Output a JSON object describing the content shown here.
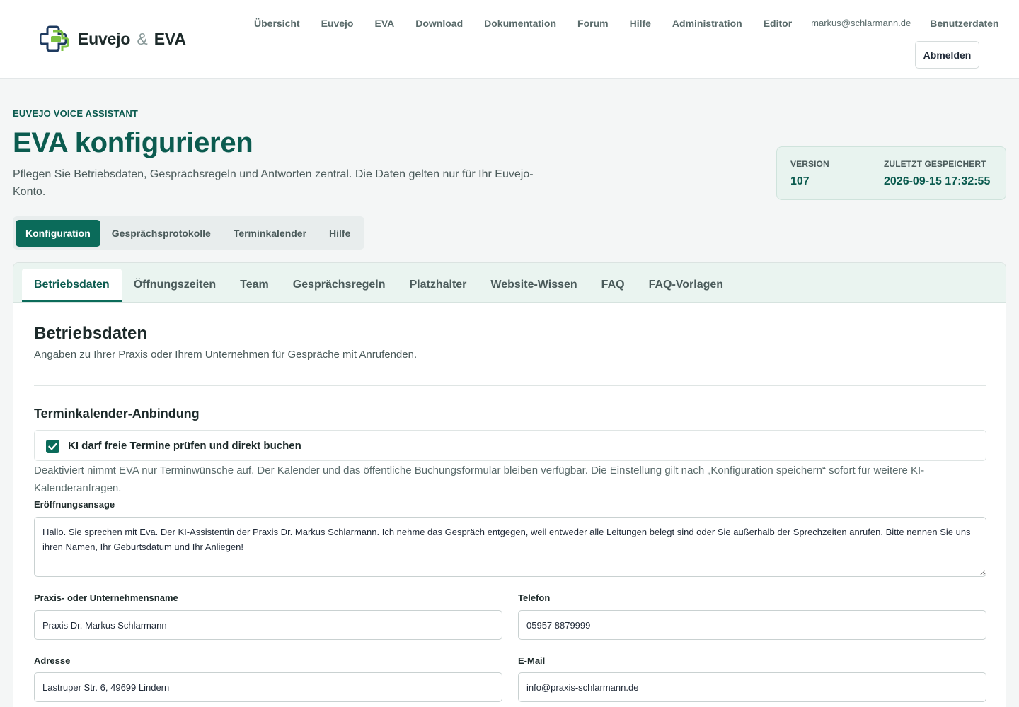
{
  "brand": {
    "name_part1": "Euvejo",
    "amp": "&",
    "name_part2": "EVA"
  },
  "nav": {
    "items": [
      "Übersicht",
      "Euvejo",
      "EVA",
      "Download",
      "Dokumentation",
      "Forum",
      "Hilfe",
      "Administration",
      "Editor"
    ],
    "email": "markus@schlarmann.de",
    "user_data": "Benutzerdaten",
    "logout": "Abmelden"
  },
  "hero": {
    "kicker": "EUVEJO VOICE ASSISTANT",
    "title": "EVA konfigurieren",
    "description": "Pflegen Sie Betriebsdaten, Gesprächsregeln und Antworten zentral. Die Daten gelten nur für Ihr Euvejo-Konto."
  },
  "version_card": {
    "version_label": "VERSION",
    "version_value": "107",
    "saved_label": "ZULETZT GESPEICHERT",
    "saved_value": "2026-09-15 17:32:55"
  },
  "primary_tabs": [
    "Konfiguration",
    "Gesprächsprotokolle",
    "Terminkalender",
    "Hilfe"
  ],
  "sub_tabs": [
    "Betriebsdaten",
    "Öffnungszeiten",
    "Team",
    "Gesprächsregeln",
    "Platzhalter",
    "Website-Wissen",
    "FAQ",
    "FAQ-Vorlagen"
  ],
  "section": {
    "title": "Betriebsdaten",
    "description": "Angaben zu Ihrer Praxis oder Ihrem Unternehmen für Gespräche mit Anrufenden.",
    "calendar_group_title": "Terminkalender-Anbindung",
    "checkbox_label": "KI darf freie Termine prüfen und direkt buchen",
    "checkbox_checked": true,
    "checkbox_help": "Deaktiviert nimmt EVA nur Terminwünsche auf. Der Kalender und das öffentliche Buchungsformular bleiben verfügbar. Die Einstellung gilt nach „Konfiguration speichern“ sofort für weitere KI-Kalenderanfragen."
  },
  "form": {
    "greeting_label": "Eröffnungsansage",
    "greeting_value": "Hallo. Sie sprechen mit Eva. Der KI-Assistentin der Praxis Dr. Markus Schlarmann. Ich nehme das Gespräch entgegen, weil entweder alle Leitungen belegt sind oder Sie außerhalb der Sprechzeiten anrufen. Bitte nennen Sie uns ihren Namen, Ihr Geburtsdatum und Ihr Anliegen!",
    "company_label": "Praxis- oder Unternehmensname",
    "company_value": "Praxis Dr. Markus Schlarmann",
    "phone_label": "Telefon",
    "phone_value": "05957 8879999",
    "address_label": "Adresse",
    "address_value": "Lastruper Str. 6, 49699 Lindern",
    "email_label": "E-Mail",
    "email_value": "info@praxis-schlarmann.de"
  },
  "colors": {
    "primary": "#0b6b5a",
    "primary_text": "#0b5b4f",
    "tab_bar": "#eaf4f0"
  }
}
